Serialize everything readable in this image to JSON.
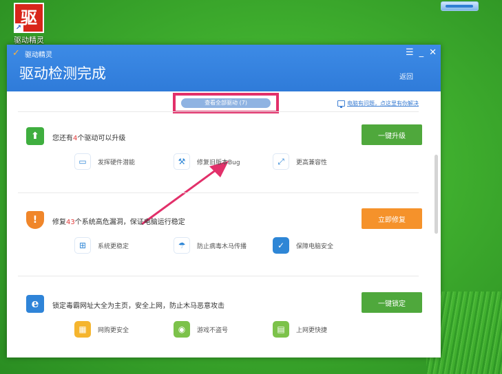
{
  "desktop": {
    "icon_glyph": "驱",
    "icon_caption": "驱动精灵",
    "shortcut_glyph": "↗"
  },
  "window": {
    "app_name": "驱动精灵",
    "title": "驱动检测完成",
    "back": "返回",
    "controls": {
      "menu": "☰",
      "minimize": "_",
      "close": "✕"
    }
  },
  "toolbar": {
    "view_all": "查看全部驱动 (7)",
    "help_link": "电脑有问题，点这里有你解决"
  },
  "sections": [
    {
      "icon": "arrow-up-icon",
      "icon_glyph": "⬆",
      "icon_color": "#3fae3f",
      "text_before": "您还有",
      "count": "4",
      "text_after": "个驱动可以升级",
      "button": "一键升级",
      "button_color": "#4fa83c",
      "features": [
        {
          "icon": "monitor-icon",
          "glyph": "▭",
          "color": "#2e86d6",
          "label": "发挥硬件潜能"
        },
        {
          "icon": "wrench-icon",
          "glyph": "🔧",
          "color": "#2e86d6",
          "label": "修复旧版本Bug"
        },
        {
          "icon": "expand-icon",
          "glyph": "⤢",
          "color": "#2e86d6",
          "label": "更高兼容性"
        }
      ]
    },
    {
      "icon": "shield-icon",
      "icon_glyph": "!",
      "icon_color": "#f0862a",
      "text_before": "修复",
      "count": "43",
      "text_after": "个系统高危漏洞，保证电脑运行稳定",
      "button": "立即修复",
      "button_color": "#f5922b",
      "features": [
        {
          "icon": "windows-icon",
          "glyph": "⊞",
          "color": "#2e86d6",
          "label": "系统更稳定"
        },
        {
          "icon": "umbrella-icon",
          "glyph": "☂",
          "color": "#2e86d6",
          "label": "防止病毒木马传播"
        },
        {
          "icon": "shield-check-icon",
          "glyph": "✓",
          "color": "#2e86d6",
          "label": "保障电脑安全"
        }
      ]
    },
    {
      "icon": "ie-icon",
      "icon_glyph": "e",
      "icon_color": "#2f84d8",
      "text_before": "锁定毒霸网址大全为主页，安全上网，防止木马恶意攻击",
      "count": "",
      "text_after": "",
      "button": "一键锁定",
      "button_color": "#4fa83c",
      "features": [
        {
          "icon": "shop-icon",
          "glyph": "▦",
          "color": "#f5b52e",
          "label": "网购更安全"
        },
        {
          "icon": "gamepad-icon",
          "glyph": "◉",
          "color": "#7cc24a",
          "label": "游戏不盗号"
        },
        {
          "icon": "browser-icon",
          "glyph": "▤",
          "color": "#7cc24a",
          "label": "上网更快捷"
        }
      ]
    }
  ],
  "colors": {
    "header_blue": "#2f7bd9",
    "highlight_pink": "#e2306a",
    "count_red": "#e23b3b"
  }
}
